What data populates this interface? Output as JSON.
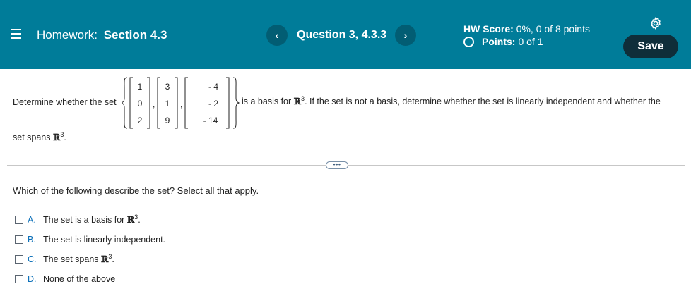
{
  "header": {
    "menu_icon": "hamburger-menu-icon",
    "homework_label": "Homework:",
    "section_label": "Section 4.3",
    "prev_icon": "‹",
    "next_icon": "›",
    "question_label": "Question 3, 4.3.3",
    "hw_score_label": "HW Score:",
    "hw_score_value": "0%, 0 of 8 points",
    "points_label": "Points:",
    "points_value": "0 of 1",
    "settings_icon": "gear-icon",
    "save_label": "Save"
  },
  "question": {
    "text_before": "Determine whether the set",
    "vectors": [
      [
        "1",
        "0",
        "2"
      ],
      [
        "3",
        "1",
        "9"
      ],
      [
        "- 4",
        "- 2",
        "- 14"
      ]
    ],
    "text_after_a": "is a basis for",
    "space": "ℝ",
    "exp": "3",
    "text_after_b": ". If the set is not a basis, determine whether the set is linearly independent and whether the",
    "line2_a": "set spans",
    "line2_b": "."
  },
  "divider_ellipsis": "•••",
  "prompt": "Which of the following describe the set? Select all that apply.",
  "options": [
    {
      "letter": "A.",
      "text": "The set is a basis for",
      "space": "ℝ",
      "exp": "3",
      "end": "."
    },
    {
      "letter": "B.",
      "text": "The set is linearly independent.",
      "space": "",
      "exp": "",
      "end": ""
    },
    {
      "letter": "C.",
      "text": "The set spans",
      "space": "ℝ",
      "exp": "3",
      "end": "."
    },
    {
      "letter": "D.",
      "text": "None of the above",
      "space": "",
      "exp": "",
      "end": ""
    }
  ],
  "colors": {
    "header_bg": "#007c99",
    "nav_btn_bg": "#025d73",
    "save_btn_bg": "#0f2e3a",
    "option_letter": "#0b6fb8"
  }
}
